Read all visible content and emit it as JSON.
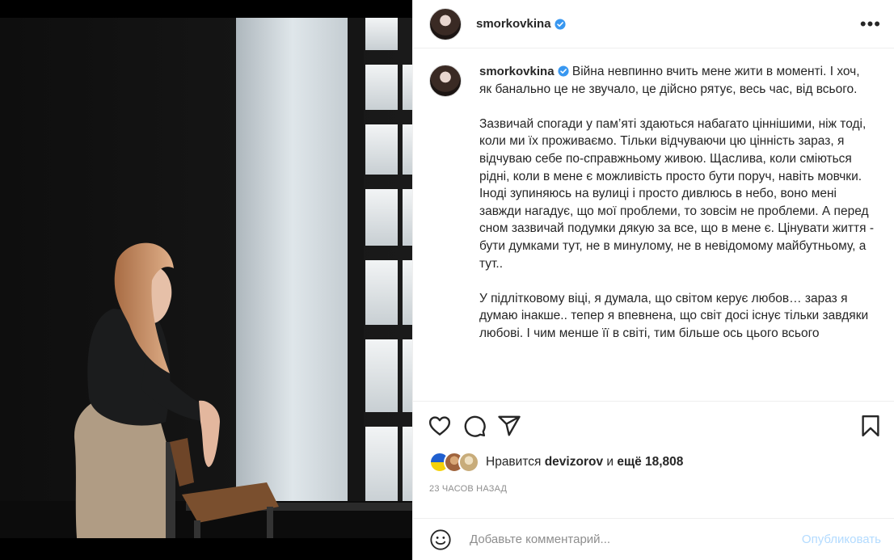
{
  "post": {
    "username": "smorkovkina",
    "caption_paragraphs": [
      "Війна невпинно вчить мене жити в моменті. І хоч, як банально це не звучало, це дійсно рятує, весь час, від всього.",
      "Зазвичай спогади у пам’яті здаються набагато ціннішими, ніж тоді, коли ми їх проживаємо. Тільки відчуваючи цю цінність зараз, я відчуваю себе по-справжньому живою. Щаслива, коли сміються рідні, коли в мене є можливість просто бути поруч, навіть мовчки. Іноді зупиняюсь на вулиці і просто дивлюсь в небо, воно мені завжди нагадує, що мої проблеми, то зовсім не проблеми. А перед сном зазвичай подумки дякую за все, що в мене є. Цінувати життя - бути думками тут, не в минулому, не в невідомому майбутньому, а тут..",
      "У підлітковому віці, я думала, що світом керує любов… зараз я думаю інакше.. тепер я впевнена, що світ досі існує тільки завдяки любові. І чим менше її в світі, тим більше ось цього всього"
    ],
    "likes_prefix": "Нравится",
    "likes_user": "devizorov",
    "likes_conj": "и",
    "likes_rest": "ещё 18,808",
    "timestamp": "23 ЧАСОВ НАЗАД"
  },
  "comment": {
    "placeholder": "Добавьте комментарий...",
    "publish_label": "Опубликовать"
  },
  "icons": {
    "more": "more-options-icon",
    "like": "heart-icon",
    "comment": "comment-icon",
    "share": "share-icon",
    "save": "bookmark-icon",
    "verified": "verified-badge-icon",
    "emoji": "emoji-icon"
  },
  "colors": {
    "verified": "#3897f0",
    "publish": "#b3dbff",
    "muted": "#8e8e8e",
    "text": "#262626"
  }
}
